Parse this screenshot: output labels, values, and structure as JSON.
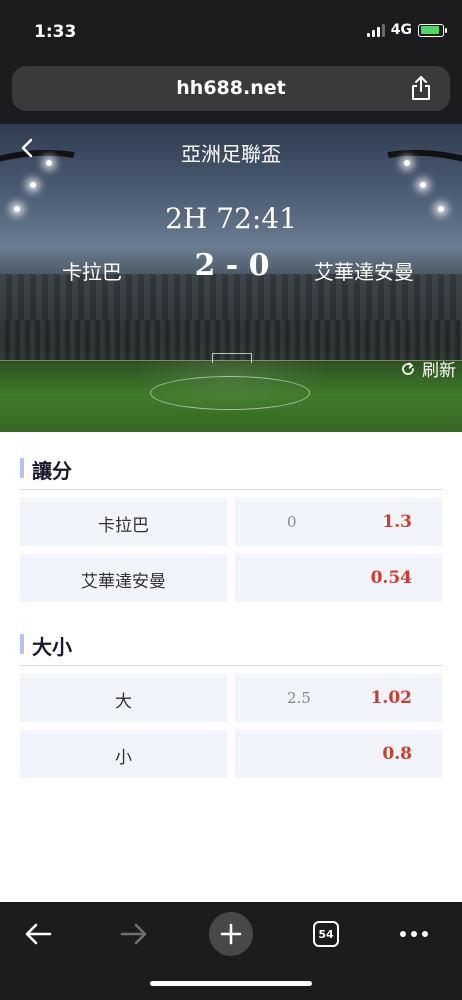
{
  "status_bar": {
    "time": "1:33",
    "network": "4G"
  },
  "browser": {
    "url": "hh688.net",
    "tab_count": "54"
  },
  "match": {
    "league": "亞洲足聯盃",
    "clock": "2H 72:41",
    "home_team": "卡拉巴",
    "away_team": "艾華達安曼",
    "score": "2 - 0",
    "refresh_label": "刷新"
  },
  "sections": {
    "handicap": {
      "title": "讓分",
      "rows": [
        {
          "name": "卡拉巴",
          "line": "0",
          "odds": "1.3"
        },
        {
          "name": "艾華達安曼",
          "line": "",
          "odds": "0.54"
        }
      ]
    },
    "over_under": {
      "title": "大小",
      "rows": [
        {
          "name": "大",
          "line": "2.5",
          "odds": "1.02"
        },
        {
          "name": "小",
          "line": "",
          "odds": "0.8"
        }
      ]
    }
  },
  "colors": {
    "odds": "#d33a2c",
    "section_accent": "#b5c3f2",
    "cell_bg": "#f2f4fc"
  },
  "icons": {
    "back": "chevron-left-icon",
    "refresh": "refresh-icon",
    "share": "share-icon",
    "nav_back": "arrow-left-icon",
    "nav_forward": "arrow-right-icon",
    "new_tab": "plus-icon",
    "tabs": "tabs-icon",
    "more": "more-icon"
  }
}
